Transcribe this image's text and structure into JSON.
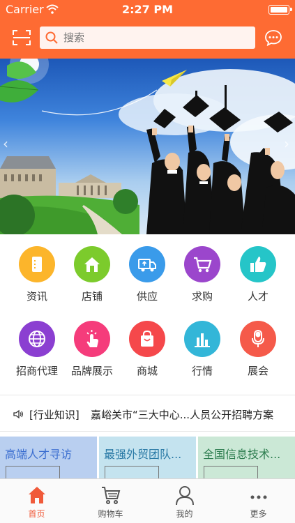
{
  "status_bar": {
    "carrier": "Carrier",
    "time": "2:27 PM",
    "battery_level": 1.0
  },
  "search": {
    "placeholder": "搜索"
  },
  "banner": {
    "slide_count": 2,
    "active_slide": 1
  },
  "categories": [
    {
      "label": "资讯",
      "icon": "document-icon",
      "color": "#fcb52b"
    },
    {
      "label": "店铺",
      "icon": "house-icon",
      "color": "#7ccb2c"
    },
    {
      "label": "供应",
      "icon": "truck-icon",
      "color": "#3a9bea"
    },
    {
      "label": "求购",
      "icon": "cart-icon",
      "color": "#9b46cc"
    },
    {
      "label": "人才",
      "icon": "thumbs-up-icon",
      "color": "#25c5c8"
    },
    {
      "label": "招商代理",
      "icon": "globe-icon",
      "color": "#8b3fd1"
    },
    {
      "label": "品牌展示",
      "icon": "hand-pointer-icon",
      "color": "#f53c7b"
    },
    {
      "label": "商城",
      "icon": "shopping-bag-icon",
      "color": "#f5484b"
    },
    {
      "label": "行情",
      "icon": "bar-chart-icon",
      "color": "#33b6d8"
    },
    {
      "label": "展会",
      "icon": "microphone-icon",
      "color": "#f55a4a"
    }
  ],
  "ticker": {
    "tag": "[行业知识]",
    "text": "嘉峪关市“三大中心...人员公开招聘方案"
  },
  "promo_cards": [
    {
      "title": "高端人才寻访",
      "bg": "#b9cff0",
      "color": "#3b6ed0"
    },
    {
      "title": "最强外贸团队...",
      "bg": "#c4e3ef",
      "color": "#2a7aa6"
    },
    {
      "title": "全国信息技术...",
      "bg": "#cbe8d6",
      "color": "#2d7d4f"
    }
  ],
  "tabs": [
    {
      "label": "首页",
      "icon": "home-icon",
      "active": true
    },
    {
      "label": "购物车",
      "icon": "cart-icon",
      "active": false
    },
    {
      "label": "我的",
      "icon": "user-icon",
      "active": false
    },
    {
      "label": "更多",
      "icon": "more-icon",
      "active": false
    }
  ],
  "colors": {
    "brand": "#fe6b33",
    "tab_active": "#f05a3a",
    "tab_inactive": "#555555"
  }
}
